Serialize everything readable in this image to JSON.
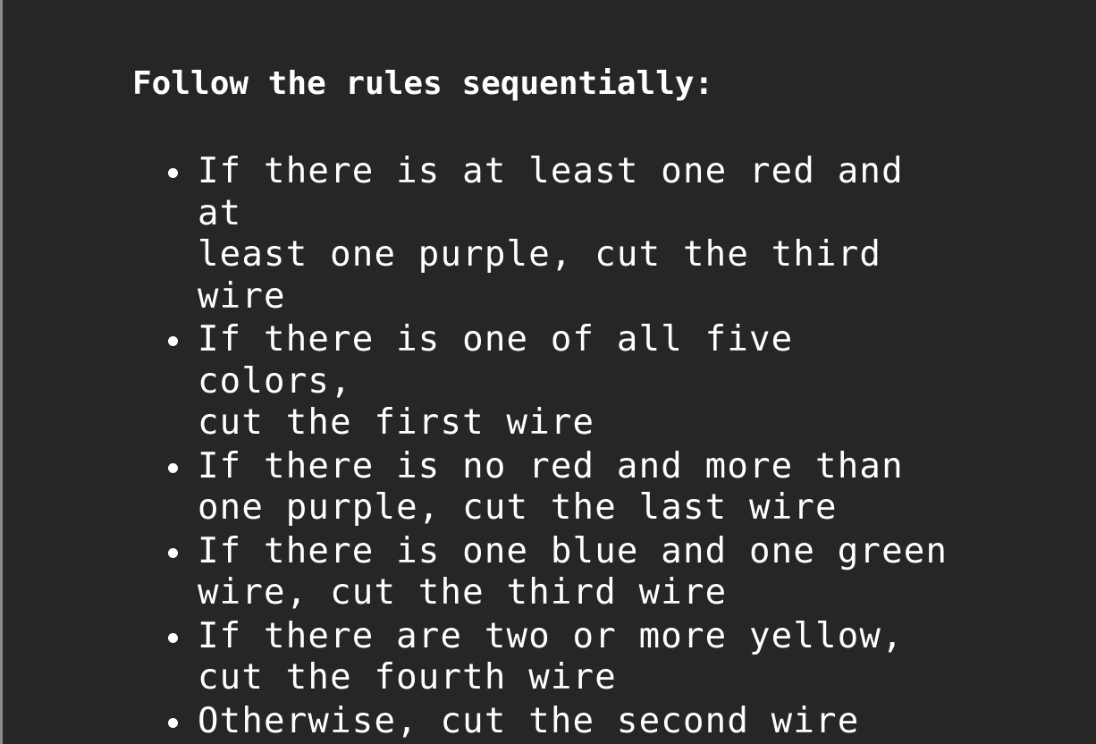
{
  "heading": "Follow the rules sequentially:",
  "rules": [
    {
      "text": "If there is at least one red and at\nleast one purple, cut the third\nwire"
    },
    {
      "text": "If there is one of all five colors,\ncut the first wire"
    },
    {
      "text": "If there is no red and more than\none purple, cut the last wire"
    },
    {
      "text": "If there is one blue and one green\nwire, cut the third wire"
    },
    {
      "text": "If there are two or more yellow,\ncut the fourth wire"
    },
    {
      "text": "Otherwise, cut the second wire"
    }
  ]
}
